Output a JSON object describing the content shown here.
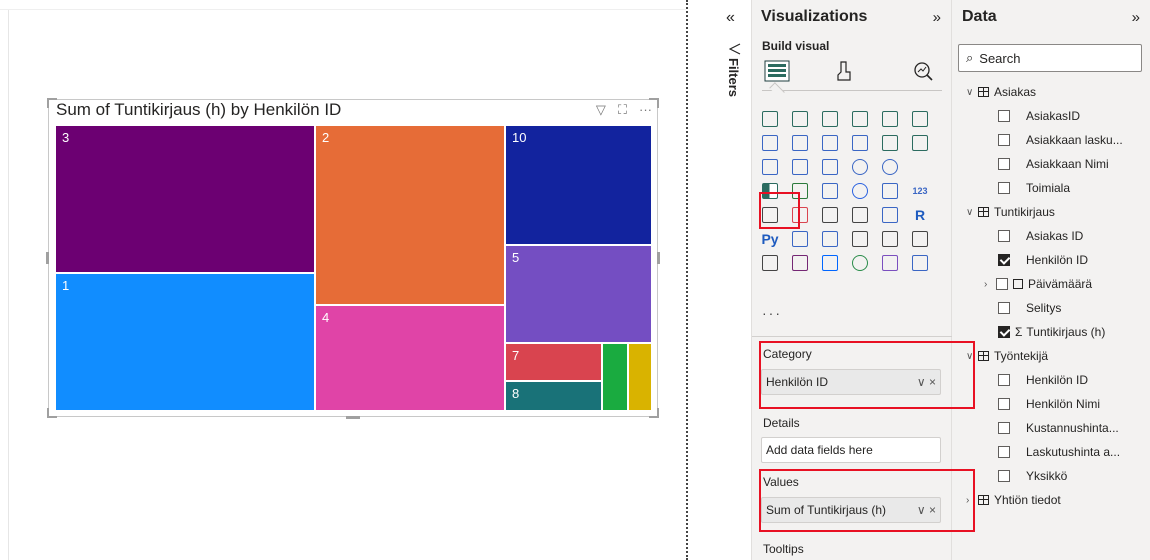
{
  "visual": {
    "title": "Sum of Tuntikirjaus (h) by Henkilön ID",
    "tool_icons": [
      "filter-icon",
      "focus-mode-icon",
      "more-options-icon"
    ],
    "tool_glyphs": [
      "▽",
      "⛶",
      "···"
    ],
    "treemap": [
      {
        "label": "3",
        "color": "#6c0072"
      },
      {
        "label": "2",
        "color": "#e66c37"
      },
      {
        "label": "10",
        "color": "#12239e"
      },
      {
        "label": "1",
        "color": "#118dff"
      },
      {
        "label": "5",
        "color": "#744ec2"
      },
      {
        "label": "4",
        "color": "#e044a7"
      },
      {
        "label": "7",
        "color": "#d9444f"
      },
      {
        "label": "8",
        "color": "#197278"
      },
      {
        "label": "",
        "color": "#1aab40"
      },
      {
        "label": "",
        "color": "#d9b300"
      }
    ]
  },
  "filters": {
    "label": "Filters",
    "collapse_glyph": "«"
  },
  "visualizations": {
    "title": "Visualizations",
    "expand_glyph": "»",
    "build_visual_label": "Build visual",
    "more_label": "···",
    "wells": {
      "category": {
        "label": "Category",
        "field": "Henkilön ID"
      },
      "details": {
        "label": "Details",
        "placeholder": "Add data fields here"
      },
      "values": {
        "label": "Values",
        "field": "Sum of Tuntikirjaus (h)"
      },
      "tooltips": {
        "label": "Tooltips"
      }
    },
    "field_controls": "∨ ×"
  },
  "data": {
    "title": "Data",
    "expand_glyph": "»",
    "search_placeholder": "Search",
    "tables": [
      {
        "name": "Asiakas",
        "fields": [
          "AsiakasID",
          "Asiakkaan lasku...",
          "Asiakkaan Nimi",
          "Toimiala"
        ]
      },
      {
        "name": "Tuntikirjaus",
        "fields": [
          "Asiakas ID",
          "Henkilön ID",
          "Päivämäärä",
          "Selitys",
          "Tuntikirjaus (h)"
        ]
      },
      {
        "name": "Työntekijä",
        "fields": [
          "Henkilön ID",
          "Henkilön Nimi",
          "Kustannushinta...",
          "Laskutushinta a...",
          "Yksikkö"
        ]
      },
      {
        "name": "Yhtiön tiedot",
        "fields": []
      }
    ],
    "sigma": "Σ"
  },
  "colors": {
    "highlight_red": "#e81123",
    "pane_bg": "#f3f2f1"
  }
}
